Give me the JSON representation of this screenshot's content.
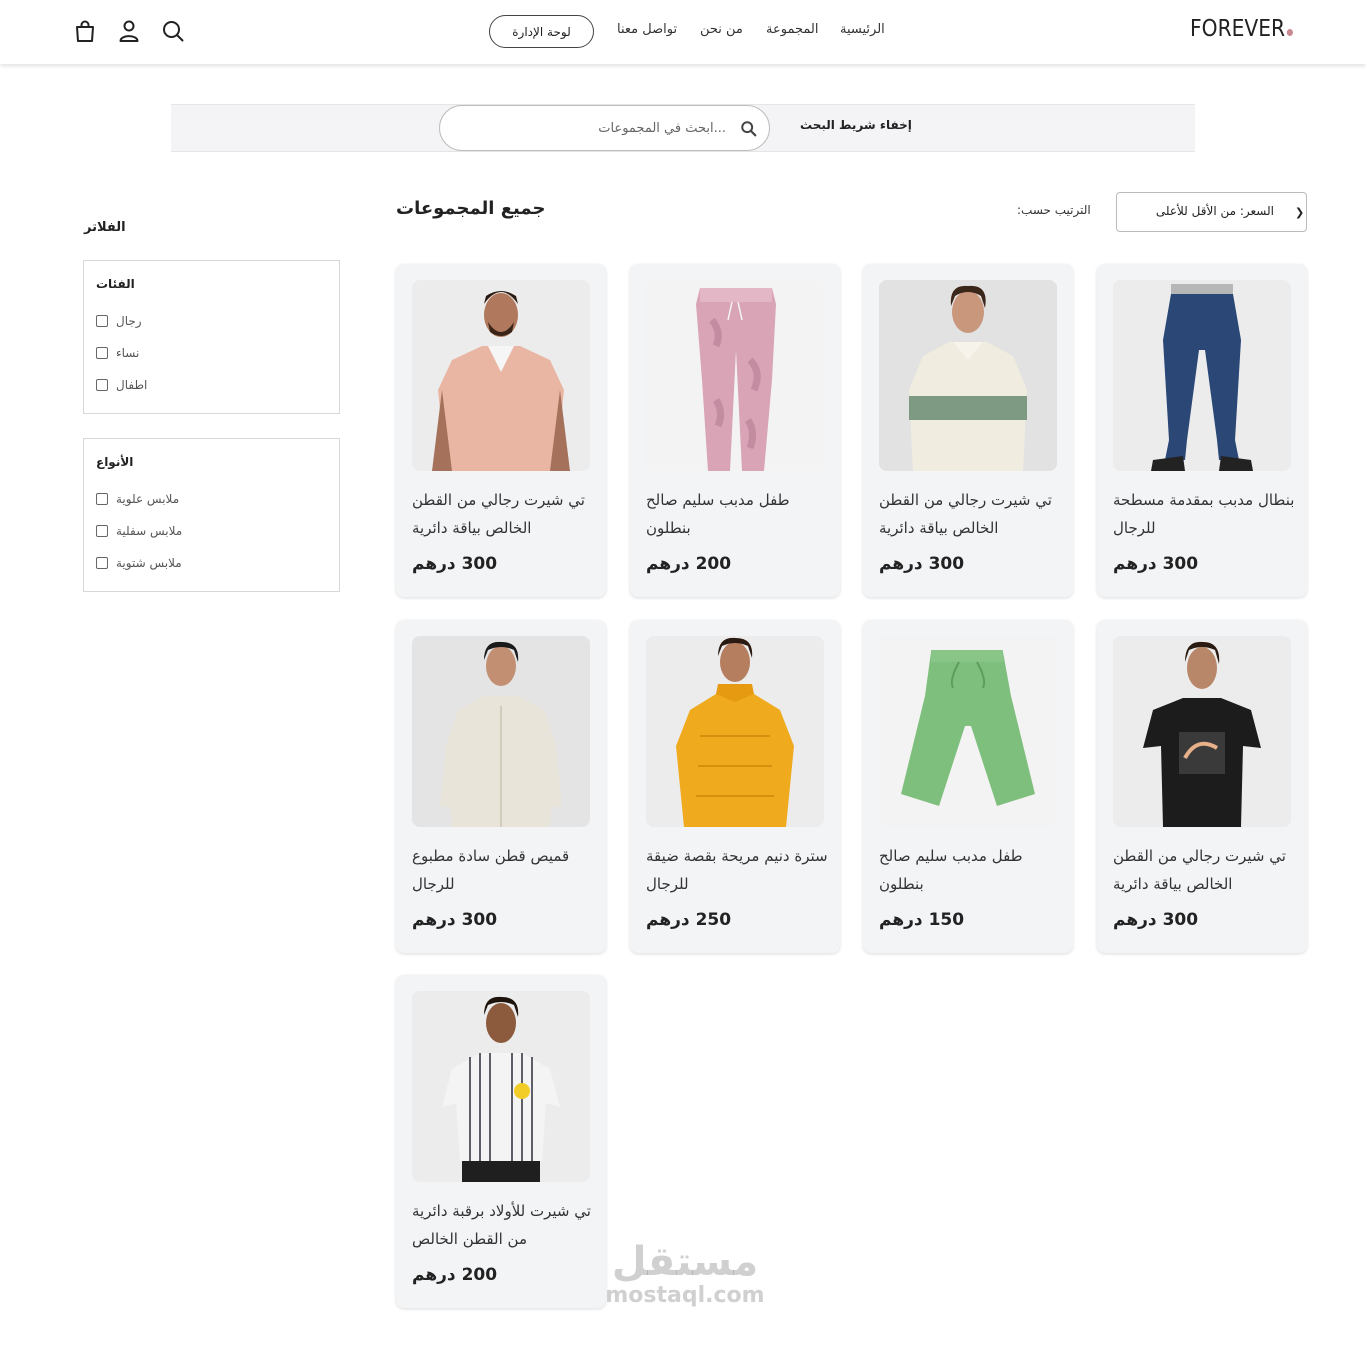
{
  "header": {
    "logo": "FOREVER",
    "nav": [
      "الرئيسية",
      "المجموعة",
      "من نحن",
      "تواصل معنا"
    ],
    "admin_button": "لوحة الإدارة",
    "icons": [
      "search-icon",
      "user-icon",
      "cart-icon"
    ]
  },
  "search": {
    "placeholder": "...ابحث في المجموعات",
    "hide_label": "إخفاء شريط البحث"
  },
  "filters": {
    "title": "الفلاتر",
    "categories": {
      "title": "الفئات",
      "options": [
        "رجال",
        "نساء",
        "اطفال"
      ]
    },
    "types": {
      "title": "الأنواع",
      "options": [
        "ملابس علوية",
        "ملابس سفلية",
        "ملابس شتوية"
      ]
    }
  },
  "main": {
    "title": "جميع المجموعات",
    "sort_label": "الترتيب حسب:",
    "sort_value": "السعر: من الأقل للأعلى"
  },
  "products": [
    {
      "name": "تي شيرت رجالي من القطن الخالص بياقة دائرية",
      "price": "300 درهم",
      "image": "man-pink-polo-shirt"
    },
    {
      "name": "طفل مدبب سليم صالح بنطلون",
      "price": "200 درهم",
      "image": "pink-patterned-joggers"
    },
    {
      "name": "تي شيرت رجالي من القطن الخالص بياقة دائرية",
      "price": "300 درهم",
      "image": "man-striped-sweatshirt"
    },
    {
      "name": "بنطال مدبب بمقدمة مسطحة للرجال",
      "price": "300 درهم",
      "image": "navy-track-pants"
    },
    {
      "name": "قميص قطن سادة مطبوع للرجال",
      "price": "300 درهم",
      "image": "man-printed-shirt"
    },
    {
      "name": "سترة دنيم مريحة بقصة ضيقة للرجال",
      "price": "250 درهم",
      "image": "man-yellow-puffer-jacket"
    },
    {
      "name": "طفل مدبب سليم صالح بنطلون",
      "price": "150 درهم",
      "image": "green-kids-pants"
    },
    {
      "name": "تي شيرت رجالي من القطن الخالص بياقة دائرية",
      "price": "300 درهم",
      "image": "man-black-tshirt"
    },
    {
      "name": "تي شيرت للأولاد برقبة دائرية من القطن الخالص",
      "price": "200 درهم",
      "image": "boy-striped-shirt"
    }
  ],
  "watermark": {
    "ar": "مستقل",
    "en": "mostaql.com"
  }
}
